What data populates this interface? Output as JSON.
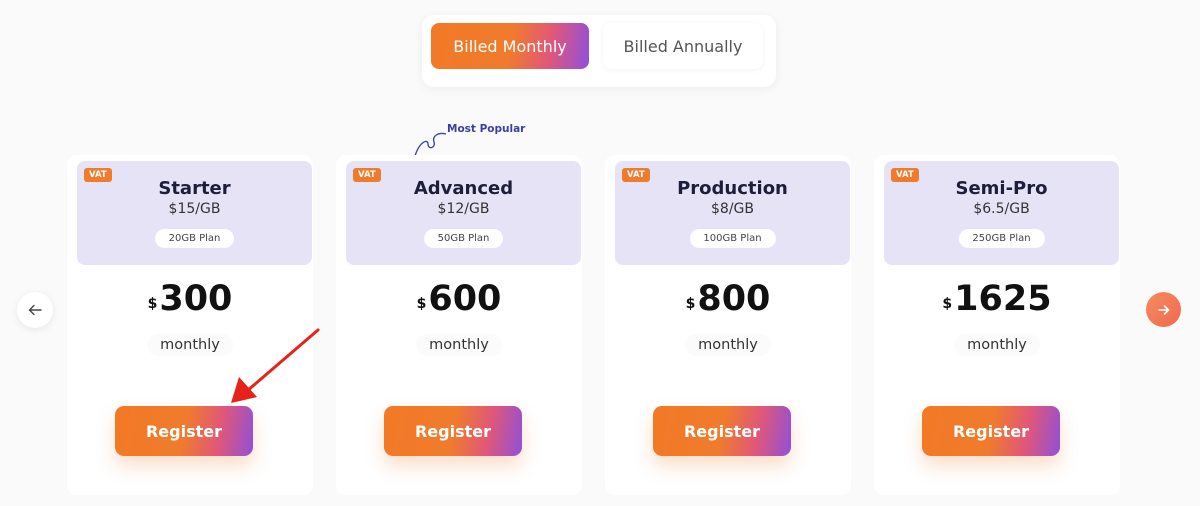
{
  "billing_toggle": {
    "monthly_label": "Billed Monthly",
    "annually_label": "Billed Annually",
    "active": "monthly"
  },
  "annotation": {
    "most_popular": "Most Popular"
  },
  "plans": [
    {
      "vat": "VAT",
      "name": "Starter",
      "rate": "$15/GB",
      "size": "20GB Plan",
      "currency": "$",
      "price": "300",
      "period": "monthly",
      "cta": "Register"
    },
    {
      "vat": "VAT",
      "name": "Advanced",
      "rate": "$12/GB",
      "size": "50GB Plan",
      "currency": "$",
      "price": "600",
      "period": "monthly",
      "cta": "Register"
    },
    {
      "vat": "VAT",
      "name": "Production",
      "rate": "$8/GB",
      "size": "100GB Plan",
      "currency": "$",
      "price": "800",
      "period": "monthly",
      "cta": "Register"
    },
    {
      "vat": "VAT",
      "name": "Semi-Pro",
      "rate": "$6.5/GB",
      "size": "250GB Plan",
      "currency": "$",
      "price": "1625",
      "period": "monthly",
      "cta": "Register"
    }
  ],
  "nav": {
    "prev_icon": "arrow-left-icon",
    "next_icon": "arrow-right-icon"
  },
  "colors": {
    "accent_orange": "#f07b2c",
    "accent_purple": "#8e4fe0",
    "card_header": "#e6e3f7",
    "annotation_arrow": "#e5231b"
  }
}
